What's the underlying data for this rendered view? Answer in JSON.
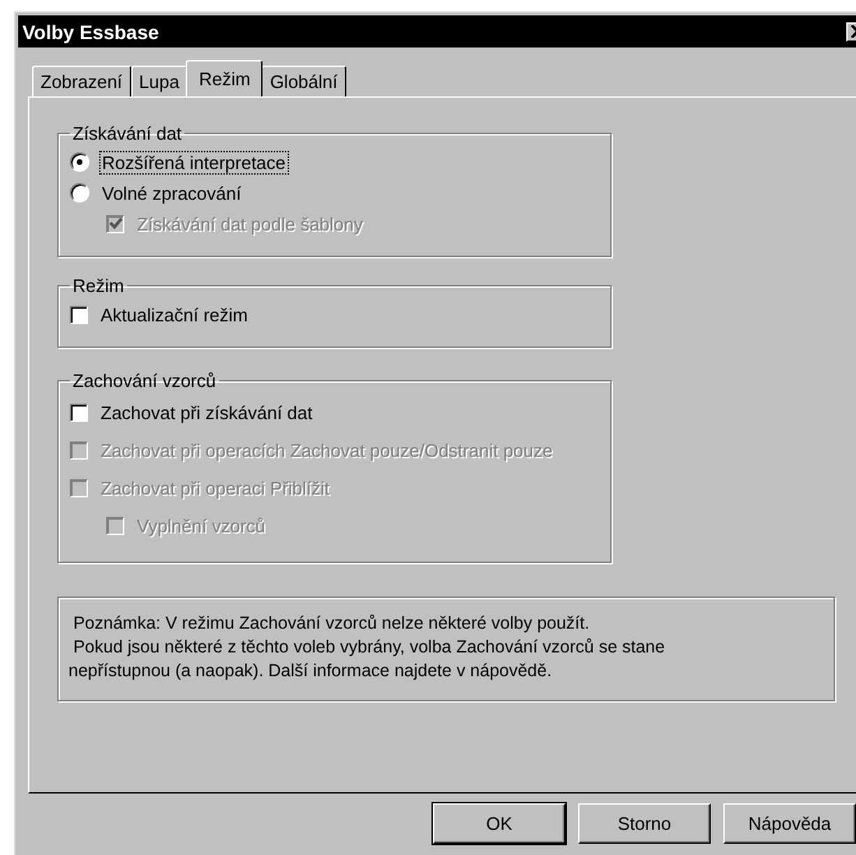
{
  "window": {
    "title": "Volby Essbase"
  },
  "tabs": [
    {
      "label": "Zobrazení",
      "selected": false
    },
    {
      "label": "Lupa",
      "selected": false
    },
    {
      "label": "Režim",
      "selected": true
    },
    {
      "label": "Globální",
      "selected": false
    }
  ],
  "groups": [
    {
      "title": "Získávání dat",
      "items": [
        {
          "kind": "radio",
          "label": "Rozšířená interpretace",
          "selected": true,
          "disabled": false,
          "focused": true
        },
        {
          "kind": "radio",
          "label": "Volné zpracování",
          "selected": false,
          "disabled": false,
          "focused": false,
          "children": [
            {
              "kind": "checkbox",
              "label": "Získávání dat podle šablony",
              "checked": true,
              "disabled": true,
              "focused": false
            }
          ]
        }
      ]
    },
    {
      "title": "Režim",
      "items": [
        {
          "kind": "checkbox",
          "label": "Aktualizační režim",
          "checked": false,
          "disabled": false,
          "focused": false
        }
      ]
    },
    {
      "title": "Zachování vzorců",
      "items": [
        {
          "kind": "checkbox",
          "label": "Zachovat při získávání dat",
          "checked": false,
          "disabled": false,
          "focused": false
        },
        {
          "kind": "checkbox",
          "label": "Zachovat při operacích Zachovat pouze/Odstranit pouze",
          "checked": false,
          "disabled": true,
          "focused": false
        },
        {
          "kind": "checkbox",
          "label": "Zachovat při operaci Přiblížit",
          "checked": false,
          "disabled": true,
          "focused": false,
          "children": [
            {
              "kind": "checkbox",
              "label": "Vyplnění vzorců",
              "checked": false,
              "disabled": true,
              "focused": false
            }
          ]
        }
      ]
    }
  ],
  "note": [
    " Poznámka: V režimu Zachování vzorců nelze některé volby použít.",
    " Pokud jsou některé z těchto voleb vybrány, volba Zachování vzorců se stane",
    "nepřístupnou (a naopak). Další informace najdete v nápovědě."
  ],
  "buttons": [
    {
      "label": "OK",
      "default": true
    },
    {
      "label": "Storno",
      "default": false
    },
    {
      "label": "Nápověda",
      "default": false
    }
  ]
}
